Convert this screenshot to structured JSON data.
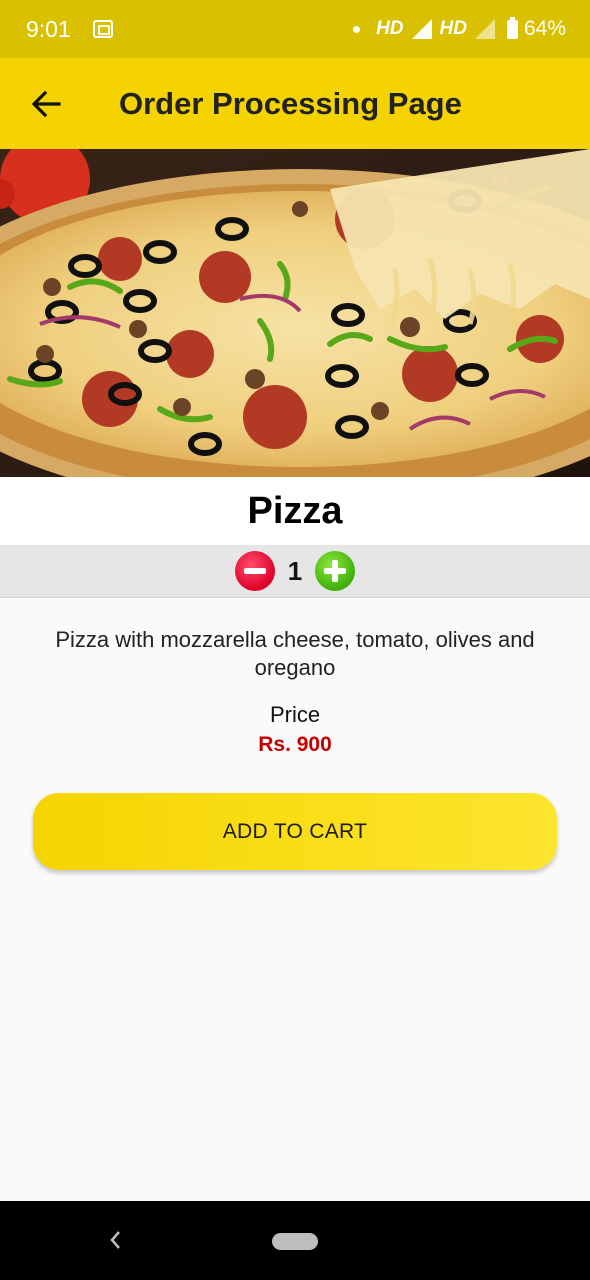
{
  "status_bar": {
    "time": "9:01",
    "network_1": "HD",
    "network_2": "HD",
    "battery": "64%"
  },
  "app_bar": {
    "title": "Order Processing Page",
    "back_icon": "arrow-left-icon"
  },
  "product": {
    "image_alt": "pizza-photo",
    "name": "Pizza",
    "quantity": "1",
    "description": "Pizza with mozzarella cheese, tomato, olives and oregano",
    "price_label": "Price",
    "price_value": "Rs. 900"
  },
  "actions": {
    "add_to_cart": "ADD TO CART"
  },
  "colors": {
    "status_bar": "#d9c000",
    "app_bar": "#f4d300",
    "button": "#f5d500",
    "price": "#c40000",
    "minus": "#e0002a",
    "plus": "#3fae0a"
  }
}
